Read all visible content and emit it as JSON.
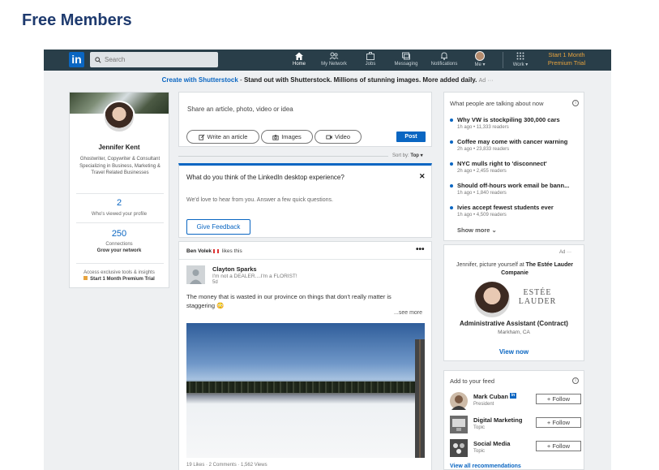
{
  "page": {
    "heading": "Free Members"
  },
  "nav": {
    "logo": "in",
    "search_placeholder": "Search",
    "items": [
      {
        "label": "Home",
        "icon": "home-icon"
      },
      {
        "label": "My Network",
        "icon": "network-icon"
      },
      {
        "label": "Jobs",
        "icon": "briefcase-icon"
      },
      {
        "label": "Messaging",
        "icon": "messaging-icon"
      },
      {
        "label": "Notifications",
        "icon": "bell-icon"
      },
      {
        "label": "Me ▾",
        "icon": "avatar"
      },
      {
        "label": "Work ▾",
        "icon": "grid-icon"
      }
    ],
    "premium_line1": "Start 1 Month",
    "premium_line2": "Premium Trial"
  },
  "adline": {
    "link": "Create with Shutterstock",
    "sep": " - ",
    "bold": "Stand out with Shutterstock. Millions of stunning images. More added daily.",
    "ad": "Ad",
    "more": "···"
  },
  "profile": {
    "name": "Jennifer Kent",
    "headline": "Ghostwriter, Copywriter & Consultant Specializing in Business, Marketing & Travel Related Businesses",
    "views_count": "2",
    "views_label": "Who's viewed your profile",
    "connections_count": "250",
    "connections_label": "Connections",
    "grow_label": "Grow your network",
    "premium_text": "Access exclusive tools & insights",
    "premium_link": "Start 1 Month Premium Trial"
  },
  "share": {
    "prompt": "Share an article, photo, video or idea",
    "write_article": "Write an article",
    "images": "Images",
    "video": "Video",
    "post": "Post"
  },
  "sort": {
    "label": "Sort by:",
    "value": "Top ▾"
  },
  "feedback": {
    "title": "What do you think of the LinkedIn desktop experience?",
    "body": "We'd love to hear from you. Answer a few quick questions.",
    "button": "Give Feedback",
    "close": "✕"
  },
  "post": {
    "actor_name": "Ben Volek",
    "actor_action": "likes this",
    "more": "•••",
    "author": "Clayton Sparks",
    "author_title": "I'm not a DEALER....I'm a FLORIST!",
    "time": "5d",
    "text": "The money that is wasted in our province on things that don't really matter is staggering 😳",
    "see_more": "...see more",
    "stats": "19 Likes · 2 Comments · 1,562 Views"
  },
  "news": {
    "header": "What people are talking about now",
    "items": [
      {
        "title": "Why VW is stockpiling 300,000 cars",
        "sub": "1h ago • 11,333 readers"
      },
      {
        "title": "Coffee may come with cancer warning",
        "sub": "2h ago • 23,833 readers"
      },
      {
        "title": "NYC mulls right to 'disconnect'",
        "sub": "2h ago • 2,455 readers"
      },
      {
        "title": "Should off-hours work email be bann...",
        "sub": "1h ago • 1,840 readers"
      },
      {
        "title": "Ivies accept fewest students ever",
        "sub": "1h ago • 4,509 readers"
      }
    ],
    "show_more": "Show more ⌄"
  },
  "ad": {
    "label": "Ad ···",
    "text_pre": "Jennifer, picture yourself at",
    "company": "The Estée Lauder Companie",
    "brand_line1": "ESTÉE",
    "brand_line2": "LAUDER",
    "role": "Administrative Assistant (Contract)",
    "location": "Markham, CA",
    "cta": "View now"
  },
  "feed": {
    "header": "Add to your feed",
    "items": [
      {
        "name": "Mark Cuban",
        "sub": "President",
        "follow": "+  Follow"
      },
      {
        "name": "Digital Marketing",
        "sub": "Topic",
        "follow": "+  Follow"
      },
      {
        "name": "Social Media",
        "sub": "Topic",
        "follow": "+  Follow"
      }
    ],
    "view_all": "View all recommendations"
  },
  "colors": {
    "nav": "#293e49",
    "brand": "#0a66c2",
    "premium": "#e7a33e"
  }
}
